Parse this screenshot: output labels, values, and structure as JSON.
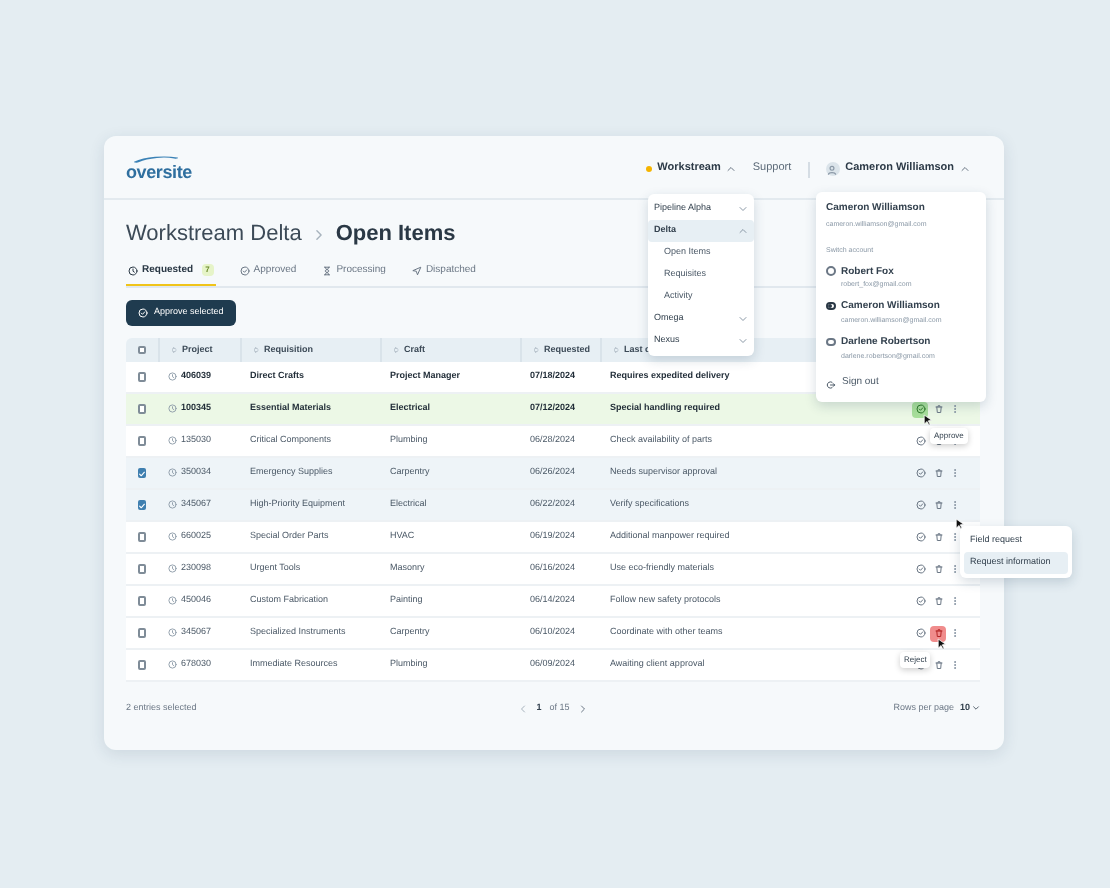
{
  "logo": "oversite",
  "nav": {
    "workstream": {
      "label": "Workstream",
      "expanded": true
    },
    "support": "Support",
    "user": {
      "name": "Cameron Williamson",
      "expanded": true
    }
  },
  "breadcrumb": [
    "Workstream Delta",
    "Open Items"
  ],
  "tabs": [
    {
      "label": "Requested",
      "badge": "7",
      "selected": true
    },
    {
      "label": "Approved",
      "selected": false
    },
    {
      "label": "Processing",
      "selected": false
    },
    {
      "label": "Dispatched",
      "selected": false
    }
  ],
  "approve_button": "Approve selected",
  "table": {
    "all_checked": false,
    "columns": [
      "Project",
      "Requisition",
      "Craft",
      "Requested",
      "Last c"
    ],
    "rows": [
      {
        "checked": false,
        "unread": true,
        "project": "406039",
        "requisition": "Direct Crafts",
        "craft": "Project Manager",
        "requested": "07/18/2024",
        "note": "Requires expedited delivery"
      },
      {
        "checked": false,
        "unread": true,
        "approve_hovered": true,
        "reject_hovered": false,
        "menu_hovered": false,
        "tooltip": "Approve",
        "project": "100345",
        "requisition": "Essential Materials",
        "craft": "Electrical",
        "requested": "07/12/2024",
        "note": "Special handling required"
      },
      {
        "checked": false,
        "unread": false,
        "approve_hovered": false,
        "reject_hovered": false,
        "menu_hovered": false,
        "project": "135030",
        "requisition": "Critical Components",
        "craft": "Plumbing",
        "requested": "06/28/2024",
        "note": "Check availability of parts"
      },
      {
        "checked": true,
        "unread": false,
        "approve_hovered": false,
        "reject_hovered": false,
        "menu_hovered": false,
        "project": "350034",
        "requisition": "Emergency Supplies",
        "craft": "Carpentry",
        "requested": "06/26/2024",
        "note": "Needs supervisor approval"
      },
      {
        "checked": true,
        "unread": false,
        "approve_hovered": false,
        "reject_hovered": false,
        "menu_hovered": true,
        "project": "345067",
        "requisition": "High-Priority Equipment",
        "craft": "Electrical",
        "requested": "06/22/2024",
        "note": "Verify specifications"
      },
      {
        "checked": false,
        "unread": false,
        "approve_hovered": false,
        "reject_hovered": false,
        "menu_hovered": false,
        "project": "660025",
        "requisition": "Special Order Parts",
        "craft": "HVAC",
        "requested": "06/19/2024",
        "note": "Additional manpower required"
      },
      {
        "checked": false,
        "unread": false,
        "approve_hovered": false,
        "reject_hovered": false,
        "menu_hovered": false,
        "project": "230098",
        "requisition": "Urgent Tools",
        "craft": "Masonry",
        "requested": "06/16/2024",
        "note": "Use eco-friendly materials"
      },
      {
        "checked": false,
        "unread": false,
        "approve_hovered": false,
        "reject_hovered": false,
        "menu_hovered": false,
        "project": "450046",
        "requisition": "Custom Fabrication",
        "craft": "Painting",
        "requested": "06/14/2024",
        "note": "Follow new safety protocols"
      },
      {
        "checked": false,
        "unread": false,
        "approve_hovered": false,
        "reject_hovered": true,
        "menu_hovered": false,
        "tooltip": "Reject",
        "project": "345067",
        "requisition": "Specialized Instruments",
        "craft": "Carpentry",
        "requested": "06/10/2024",
        "note": "Coordinate with other teams"
      },
      {
        "checked": false,
        "unread": false,
        "approve_hovered": false,
        "reject_hovered": false,
        "menu_hovered": false,
        "project": "678030",
        "requisition": "Immediate Resources",
        "craft": "Plumbing",
        "requested": "06/09/2024",
        "note": "Awaiting client approval"
      }
    ]
  },
  "footer": {
    "selection": "2 entries selected",
    "page": "1",
    "of_pages": "of 15",
    "rows_per_page_label": "Rows per page",
    "rows_per_page": "10"
  },
  "workstream_menu": [
    {
      "label": "Pipeline Alpha",
      "expanded": false,
      "selected": false
    },
    {
      "label": "Delta",
      "expanded": true,
      "selected": true,
      "children": [
        {
          "label": "Open Items"
        },
        {
          "label": "Requisites"
        },
        {
          "label": "Activity"
        }
      ]
    },
    {
      "label": "Omega",
      "expanded": false,
      "selected": false
    },
    {
      "label": "Nexus",
      "expanded": false,
      "selected": false
    }
  ],
  "account_menu": {
    "name": "Cameron Williamson",
    "email": "cameron.williamson@gmail.com",
    "switch_label": "Switch account",
    "accounts": [
      {
        "name": "Robert Fox",
        "email": "robert_fox@gmail.com",
        "selected": false
      },
      {
        "name": "Cameron Williamson",
        "email": "cameron.williamson@gmail.com",
        "selected": true
      },
      {
        "name": "Darlene Robertson",
        "email": "darlene.robertson@gmail.com",
        "selected": false
      }
    ],
    "sign_out": "Sign out"
  },
  "row_menu": [
    {
      "label": "Field request",
      "selected": false
    },
    {
      "label": "Request information",
      "selected": true
    }
  ]
}
